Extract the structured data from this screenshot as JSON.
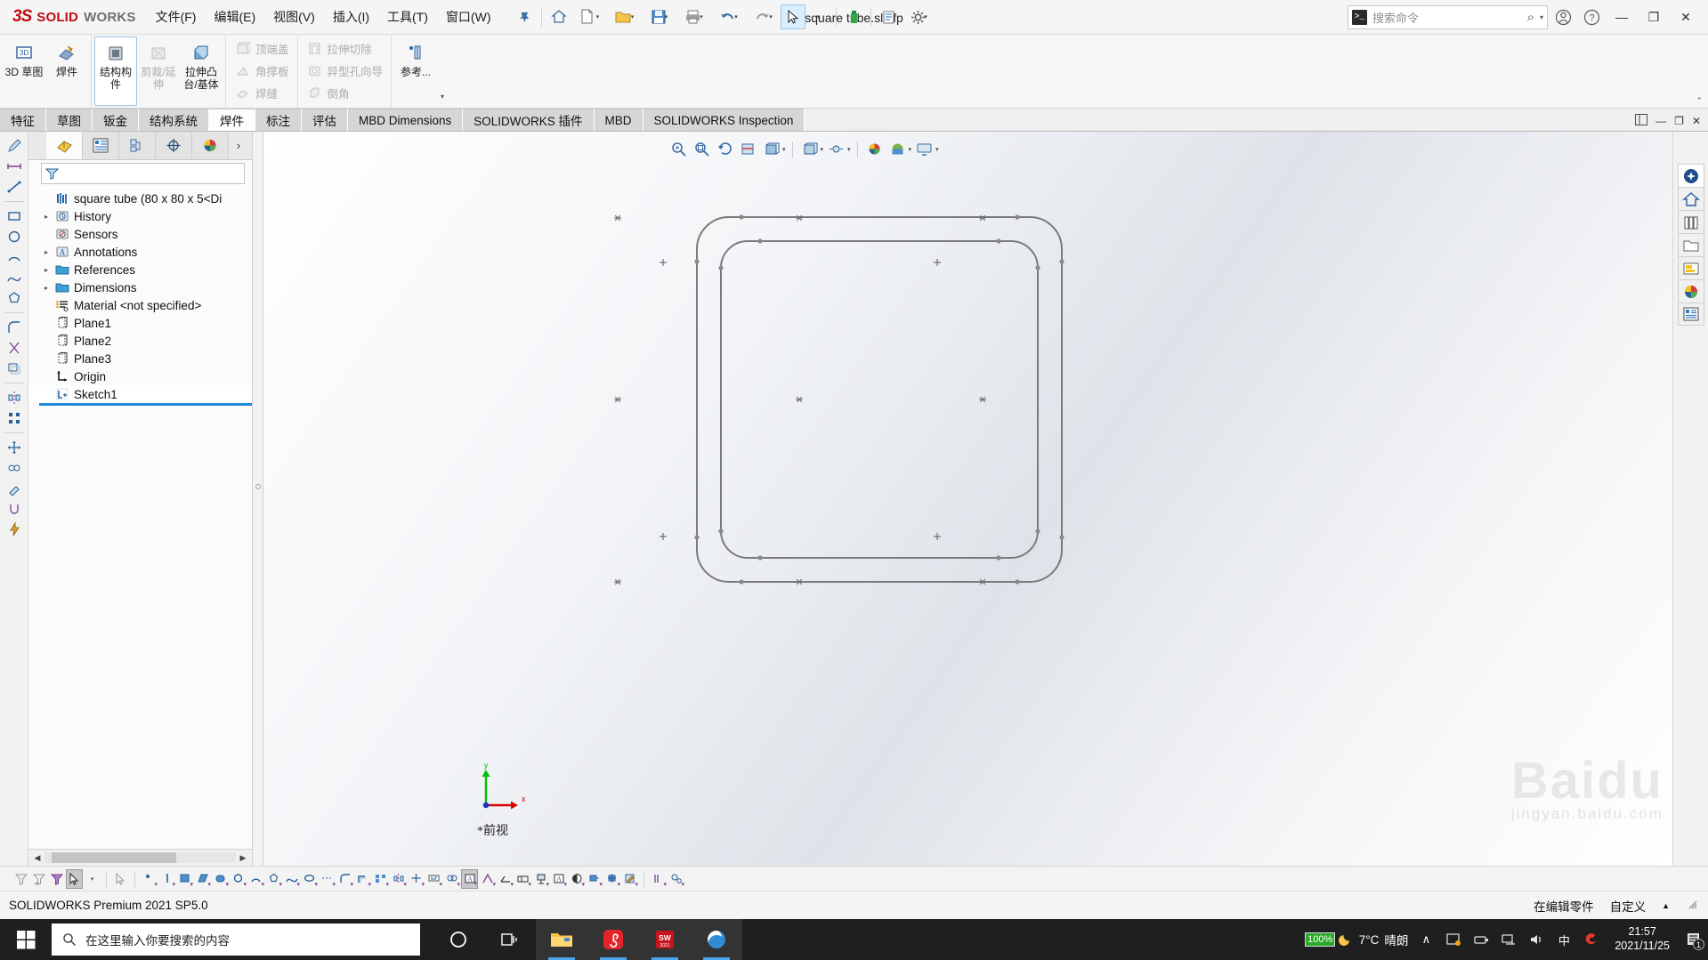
{
  "titlebar": {
    "brand_ds": "3S",
    "brand_solid": "SOLID",
    "brand_works": "WORKS",
    "document_title": "square tube.sldlfp",
    "menus": [
      "文件(F)",
      "编辑(E)",
      "视图(V)",
      "插入(I)",
      "工具(T)",
      "窗口(W)"
    ],
    "search_placeholder": "搜索命令",
    "min_label": "—",
    "restore_label": "❐",
    "close_label": "✕"
  },
  "ribbon": {
    "groups": [
      {
        "big": [
          {
            "label": "3D 草图",
            "icon": "3d-sketch-icon",
            "disabled": false
          },
          {
            "label": "焊件",
            "icon": "weldment-icon",
            "disabled": false
          }
        ]
      },
      {
        "big": [
          {
            "label": "结构构件",
            "icon": "structural-member-icon",
            "disabled": false,
            "selected": true
          },
          {
            "label": "剪裁/延伸",
            "icon": "trim-extend-icon",
            "disabled": true
          },
          {
            "label": "拉伸凸台/基体",
            "icon": "extrude-boss-icon",
            "disabled": false
          }
        ]
      },
      {
        "small": [
          {
            "label": "顶端盖",
            "icon": "end-cap-icon",
            "disabled": true
          },
          {
            "label": "角撑板",
            "icon": "gusset-icon",
            "disabled": true
          },
          {
            "label": "焊缝",
            "icon": "weld-bead-icon",
            "disabled": true
          }
        ]
      },
      {
        "small": [
          {
            "label": "拉伸切除",
            "icon": "extruded-cut-icon",
            "disabled": true
          },
          {
            "label": "异型孔向导",
            "icon": "hole-wizard-icon",
            "disabled": true
          },
          {
            "label": "倒角",
            "icon": "chamfer-icon",
            "disabled": true
          }
        ]
      },
      {
        "big": [
          {
            "label": "参考...",
            "icon": "reference-geometry-icon",
            "disabled": false
          }
        ]
      }
    ]
  },
  "tabs": {
    "items": [
      {
        "label": "特征",
        "active": false
      },
      {
        "label": "草图",
        "active": false
      },
      {
        "label": "钣金",
        "active": false
      },
      {
        "label": "结构系统",
        "active": false
      },
      {
        "label": "焊件",
        "active": true
      },
      {
        "label": "标注",
        "active": false
      },
      {
        "label": "评估",
        "active": false
      },
      {
        "label": "MBD Dimensions",
        "active": false
      },
      {
        "label": "SOLIDWORKS 插件",
        "active": false
      },
      {
        "label": "MBD",
        "active": false
      },
      {
        "label": "SOLIDWORKS Inspection",
        "active": false
      }
    ]
  },
  "feature_manager": {
    "tabs": [
      {
        "icon": "feature-tree-icon",
        "active": true
      },
      {
        "icon": "property-manager-icon",
        "active": false
      },
      {
        "icon": "configuration-manager-icon",
        "active": false
      },
      {
        "icon": "dimxpert-manager-icon",
        "active": false
      },
      {
        "icon": "display-manager-icon",
        "active": false
      }
    ],
    "more_label": "›",
    "filter_icon": "filter-icon",
    "tree": [
      {
        "label": "square tube  (80 x 80 x 5<Di",
        "icon": "part-icon",
        "twist": "",
        "indent": 0,
        "root": true
      },
      {
        "label": "History",
        "icon": "history-icon",
        "twist": "▸",
        "indent": 1
      },
      {
        "label": "Sensors",
        "icon": "sensors-icon",
        "twist": "",
        "indent": 1
      },
      {
        "label": "Annotations",
        "icon": "annotations-icon",
        "twist": "▸",
        "indent": 1
      },
      {
        "label": "References",
        "icon": "folder-icon",
        "twist": "▸",
        "indent": 1
      },
      {
        "label": "Dimensions",
        "icon": "folder-icon",
        "twist": "▸",
        "indent": 1
      },
      {
        "label": "Material <not specified>",
        "icon": "material-icon",
        "twist": "",
        "indent": 1
      },
      {
        "label": "Plane1",
        "icon": "plane-icon",
        "twist": "",
        "indent": 1
      },
      {
        "label": "Plane2",
        "icon": "plane-icon",
        "twist": "",
        "indent": 1
      },
      {
        "label": "Plane3",
        "icon": "plane-icon",
        "twist": "",
        "indent": 1
      },
      {
        "label": "Origin",
        "icon": "origin-icon",
        "twist": "",
        "indent": 1
      },
      {
        "label": "Sketch1",
        "icon": "sketch-icon",
        "twist": "",
        "indent": 1,
        "selected": true
      }
    ]
  },
  "viewport": {
    "view_label": "*前视",
    "triad_x": "x",
    "triad_y": "y",
    "toolbar": [
      {
        "icon": "zoom-to-fit-icon"
      },
      {
        "icon": "zoom-to-area-icon"
      },
      {
        "icon": "previous-view-icon"
      },
      {
        "icon": "section-view-icon"
      },
      {
        "icon": "view-orientation-icon"
      },
      {
        "icon": "display-style-icon"
      },
      {
        "icon": "hide-show-items-icon"
      },
      {
        "icon": "edit-appearance-icon"
      },
      {
        "icon": "apply-scene-icon"
      },
      {
        "icon": "view-settings-icon"
      }
    ]
  },
  "status_bar": {
    "left": "SOLIDWORKS Premium 2021 SP5.0",
    "editing": "在编辑零件",
    "custom": "自定义",
    "caret": "▲"
  },
  "taskbar": {
    "search_placeholder": "在这里输入你要搜索的内容",
    "apps": [
      {
        "icon": "cortana-icon",
        "active": false
      },
      {
        "icon": "task-view-icon",
        "active": false
      },
      {
        "icon": "file-explorer-icon",
        "active": true
      },
      {
        "icon": "netease-music-icon",
        "active": true
      },
      {
        "icon": "solidworks-icon",
        "active": true
      },
      {
        "icon": "edge-icon",
        "active": true
      }
    ],
    "tray": {
      "battery": "100%",
      "weather_icon": "moon-icon",
      "temperature": "7°C",
      "weather_text": "晴朗",
      "chevron": "∧",
      "time": "21:57",
      "date": "2021/11/25",
      "ime": "中",
      "notification_count": "1"
    }
  },
  "watermark": {
    "main": "Baidu",
    "sub": "jingyan.baidu.com"
  },
  "colors": {
    "brand_red": "#c00b12",
    "accent_blue": "#1e8ad6",
    "sketch_line": "#7b7b7b",
    "taskbar_bg": "#1f1f1f",
    "battery_green": "#2aa82a"
  },
  "sketch_geometry": {
    "outer_size": 410,
    "inner_size": 356,
    "outer_radius": 36,
    "inner_radius": 30,
    "description": "80 x 80 x 5 square tube cross-section sketch"
  }
}
